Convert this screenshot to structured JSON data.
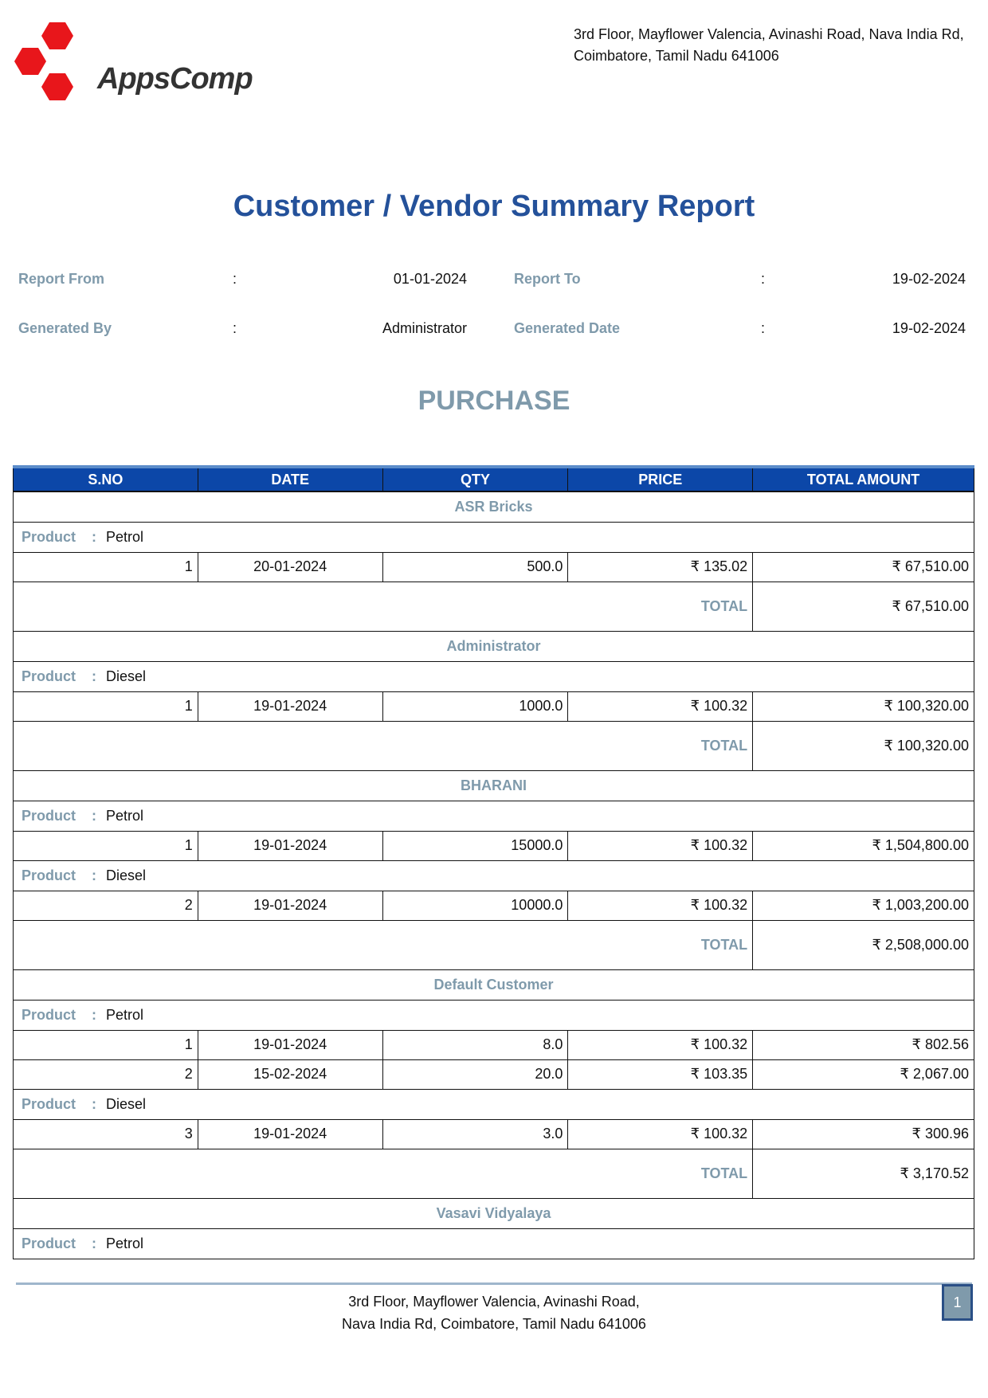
{
  "company": {
    "name": "AppsComp",
    "address_line1": "3rd Floor, Mayflower Valencia, Avinashi Road, Nava India Rd,",
    "address_line2": "Coimbatore, Tamil Nadu 641006"
  },
  "title": "Customer / Vendor Summary Report",
  "meta": {
    "report_from_label": "Report From",
    "report_from_value": "01-01-2024",
    "report_to_label": "Report To",
    "report_to_value": "19-02-2024",
    "generated_by_label": "Generated By",
    "generated_by_value": "Administrator",
    "generated_date_label": "Generated Date",
    "generated_date_value": "19-02-2024",
    "colon": ":"
  },
  "section_title": "PURCHASE",
  "table": {
    "headers": [
      "S.NO",
      "DATE",
      "QTY",
      "PRICE",
      "TOTAL AMOUNT"
    ],
    "product_label": "Product",
    "total_label": "TOTAL",
    "groups": [
      {
        "party": "ASR Bricks",
        "products": [
          {
            "name": "Petrol",
            "rows": [
              {
                "sno": "1",
                "date": "20-01-2024",
                "qty": "500.0",
                "price": "₹ 135.02",
                "amount": "₹ 67,510.00"
              }
            ]
          }
        ],
        "total": "₹ 67,510.00"
      },
      {
        "party": "Administrator",
        "products": [
          {
            "name": "Diesel",
            "rows": [
              {
                "sno": "1",
                "date": "19-01-2024",
                "qty": "1000.0",
                "price": "₹ 100.32",
                "amount": "₹ 100,320.00"
              }
            ]
          }
        ],
        "total": "₹ 100,320.00"
      },
      {
        "party": "BHARANI",
        "products": [
          {
            "name": "Petrol",
            "rows": [
              {
                "sno": "1",
                "date": "19-01-2024",
                "qty": "15000.0",
                "price": "₹ 100.32",
                "amount": "₹ 1,504,800.00"
              }
            ]
          },
          {
            "name": "Diesel",
            "rows": [
              {
                "sno": "2",
                "date": "19-01-2024",
                "qty": "10000.0",
                "price": "₹ 100.32",
                "amount": "₹ 1,003,200.00"
              }
            ]
          }
        ],
        "total": "₹ 2,508,000.00"
      },
      {
        "party": "Default Customer",
        "products": [
          {
            "name": "Petrol",
            "rows": [
              {
                "sno": "1",
                "date": "19-01-2024",
                "qty": "8.0",
                "price": "₹ 100.32",
                "amount": "₹ 802.56"
              },
              {
                "sno": "2",
                "date": "15-02-2024",
                "qty": "20.0",
                "price": "₹ 103.35",
                "amount": "₹ 2,067.00"
              }
            ]
          },
          {
            "name": "Diesel",
            "rows": [
              {
                "sno": "3",
                "date": "19-01-2024",
                "qty": "3.0",
                "price": "₹ 100.32",
                "amount": "₹ 300.96"
              }
            ]
          }
        ],
        "total": "₹ 3,170.52"
      },
      {
        "party": "Vasavi Vidyalaya",
        "products": [
          {
            "name": "Petrol",
            "rows": []
          }
        ]
      }
    ]
  },
  "footer": {
    "address_line1": "3rd Floor, Mayflower Valencia, Avinashi Road,",
    "address_line2": "Nava India Rd, Coimbatore, Tamil Nadu 641006",
    "page_number": "1"
  },
  "colors": {
    "title": "#24519a",
    "label": "#7f9aab",
    "header_bg": "#0c47a8",
    "logo_red": "#e8161b"
  }
}
